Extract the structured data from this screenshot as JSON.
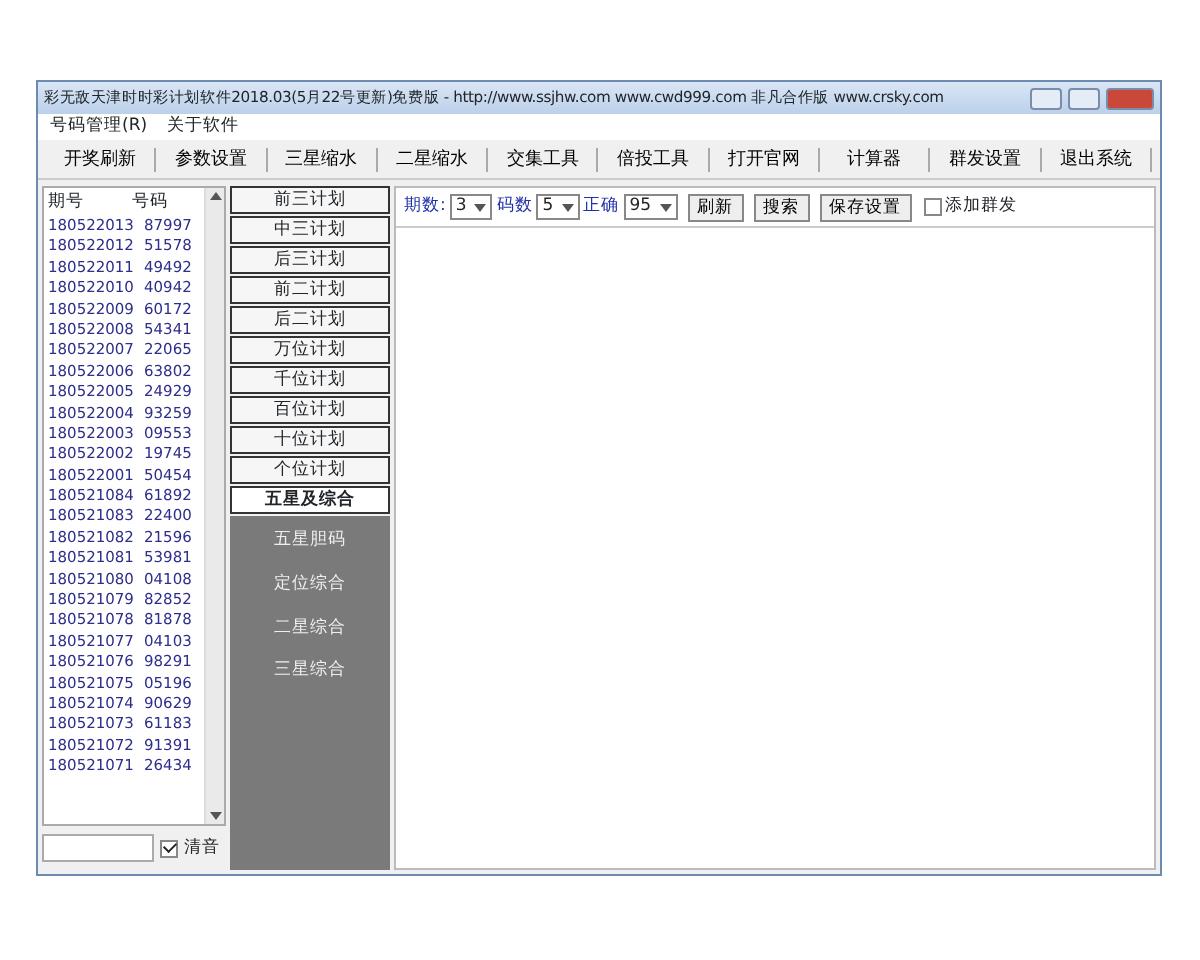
{
  "window": {
    "title": "彩无敌天津时时彩计划软件2018.03(5月22号更新)免费版 - http://www.ssjhw.com www.cwd999.com 非凡合作版 www.crsky.com"
  },
  "menu": [
    "号码管理(R)",
    "关于软件"
  ],
  "toolbar": [
    "开奖刷新",
    "参数设置",
    "三星缩水",
    "二星缩水",
    "交集工具",
    "倍投工具",
    "打开官网",
    "计算器",
    "群发设置",
    "退出系统"
  ],
  "history": {
    "columns": [
      "期号",
      "号码"
    ],
    "rows": [
      [
        "180522013",
        "87997"
      ],
      [
        "180522012",
        "51578"
      ],
      [
        "180522011",
        "49492"
      ],
      [
        "180522010",
        "40942"
      ],
      [
        "180522009",
        "60172"
      ],
      [
        "180522008",
        "54341"
      ],
      [
        "180522007",
        "22065"
      ],
      [
        "180522006",
        "63802"
      ],
      [
        "180522005",
        "24929"
      ],
      [
        "180522004",
        "93259"
      ],
      [
        "180522003",
        "09553"
      ],
      [
        "180522002",
        "19745"
      ],
      [
        "180522001",
        "50454"
      ],
      [
        "180521084",
        "61892"
      ],
      [
        "180521083",
        "22400"
      ],
      [
        "180521082",
        "21596"
      ],
      [
        "180521081",
        "53981"
      ],
      [
        "180521080",
        "04108"
      ],
      [
        "180521079",
        "82852"
      ],
      [
        "180521078",
        "81878"
      ],
      [
        "180521077",
        "04103"
      ],
      [
        "180521076",
        "98291"
      ],
      [
        "180521075",
        "05196"
      ],
      [
        "180521074",
        "90629"
      ],
      [
        "180521073",
        "61183"
      ],
      [
        "180521072",
        "91391"
      ],
      [
        "180521071",
        "26434"
      ]
    ]
  },
  "mute": {
    "label": "清音",
    "checked": true
  },
  "plans": [
    {
      "label": "前三计划",
      "selected": false
    },
    {
      "label": "中三计划",
      "selected": false
    },
    {
      "label": "后三计划",
      "selected": false
    },
    {
      "label": "前二计划",
      "selected": false
    },
    {
      "label": "后二计划",
      "selected": false
    },
    {
      "label": "万位计划",
      "selected": false
    },
    {
      "label": "千位计划",
      "selected": false
    },
    {
      "label": "百位计划",
      "selected": false
    },
    {
      "label": "十位计划",
      "selected": false
    },
    {
      "label": "个位计划",
      "selected": false
    },
    {
      "label": "五星及综合",
      "selected": true
    }
  ],
  "sub_items": [
    "五星胆码",
    "定位综合",
    "二星综合",
    "三星综合"
  ],
  "filters": [
    {
      "label": "期数:",
      "value": "3"
    },
    {
      "label": "码数",
      "value": "5"
    },
    {
      "label": "正确",
      "value": "95"
    }
  ],
  "buttons": [
    "刷新",
    "搜索",
    "保存设置"
  ],
  "add_group": {
    "label": "添加群发",
    "checked": false
  }
}
